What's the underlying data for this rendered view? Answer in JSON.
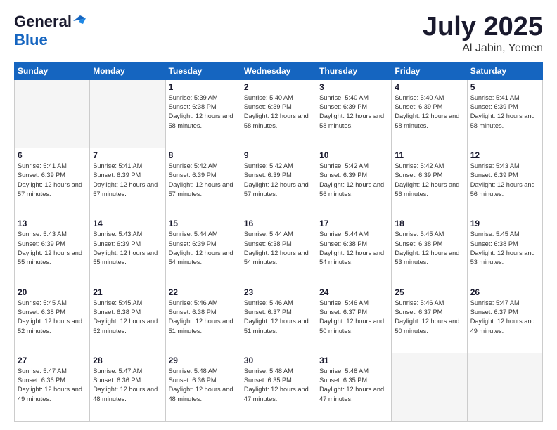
{
  "header": {
    "logo_general": "General",
    "logo_blue": "Blue",
    "month": "July 2025",
    "location": "Al Jabin, Yemen"
  },
  "days_of_week": [
    "Sunday",
    "Monday",
    "Tuesday",
    "Wednesday",
    "Thursday",
    "Friday",
    "Saturday"
  ],
  "weeks": [
    [
      {
        "day": "",
        "empty": true
      },
      {
        "day": "",
        "empty": true
      },
      {
        "day": "1",
        "sunrise": "Sunrise: 5:39 AM",
        "sunset": "Sunset: 6:38 PM",
        "daylight": "Daylight: 12 hours and 58 minutes."
      },
      {
        "day": "2",
        "sunrise": "Sunrise: 5:40 AM",
        "sunset": "Sunset: 6:39 PM",
        "daylight": "Daylight: 12 hours and 58 minutes."
      },
      {
        "day": "3",
        "sunrise": "Sunrise: 5:40 AM",
        "sunset": "Sunset: 6:39 PM",
        "daylight": "Daylight: 12 hours and 58 minutes."
      },
      {
        "day": "4",
        "sunrise": "Sunrise: 5:40 AM",
        "sunset": "Sunset: 6:39 PM",
        "daylight": "Daylight: 12 hours and 58 minutes."
      },
      {
        "day": "5",
        "sunrise": "Sunrise: 5:41 AM",
        "sunset": "Sunset: 6:39 PM",
        "daylight": "Daylight: 12 hours and 58 minutes."
      }
    ],
    [
      {
        "day": "6",
        "sunrise": "Sunrise: 5:41 AM",
        "sunset": "Sunset: 6:39 PM",
        "daylight": "Daylight: 12 hours and 57 minutes."
      },
      {
        "day": "7",
        "sunrise": "Sunrise: 5:41 AM",
        "sunset": "Sunset: 6:39 PM",
        "daylight": "Daylight: 12 hours and 57 minutes."
      },
      {
        "day": "8",
        "sunrise": "Sunrise: 5:42 AM",
        "sunset": "Sunset: 6:39 PM",
        "daylight": "Daylight: 12 hours and 57 minutes."
      },
      {
        "day": "9",
        "sunrise": "Sunrise: 5:42 AM",
        "sunset": "Sunset: 6:39 PM",
        "daylight": "Daylight: 12 hours and 57 minutes."
      },
      {
        "day": "10",
        "sunrise": "Sunrise: 5:42 AM",
        "sunset": "Sunset: 6:39 PM",
        "daylight": "Daylight: 12 hours and 56 minutes."
      },
      {
        "day": "11",
        "sunrise": "Sunrise: 5:42 AM",
        "sunset": "Sunset: 6:39 PM",
        "daylight": "Daylight: 12 hours and 56 minutes."
      },
      {
        "day": "12",
        "sunrise": "Sunrise: 5:43 AM",
        "sunset": "Sunset: 6:39 PM",
        "daylight": "Daylight: 12 hours and 56 minutes."
      }
    ],
    [
      {
        "day": "13",
        "sunrise": "Sunrise: 5:43 AM",
        "sunset": "Sunset: 6:39 PM",
        "daylight": "Daylight: 12 hours and 55 minutes."
      },
      {
        "day": "14",
        "sunrise": "Sunrise: 5:43 AM",
        "sunset": "Sunset: 6:39 PM",
        "daylight": "Daylight: 12 hours and 55 minutes."
      },
      {
        "day": "15",
        "sunrise": "Sunrise: 5:44 AM",
        "sunset": "Sunset: 6:39 PM",
        "daylight": "Daylight: 12 hours and 54 minutes."
      },
      {
        "day": "16",
        "sunrise": "Sunrise: 5:44 AM",
        "sunset": "Sunset: 6:38 PM",
        "daylight": "Daylight: 12 hours and 54 minutes."
      },
      {
        "day": "17",
        "sunrise": "Sunrise: 5:44 AM",
        "sunset": "Sunset: 6:38 PM",
        "daylight": "Daylight: 12 hours and 54 minutes."
      },
      {
        "day": "18",
        "sunrise": "Sunrise: 5:45 AM",
        "sunset": "Sunset: 6:38 PM",
        "daylight": "Daylight: 12 hours and 53 minutes."
      },
      {
        "day": "19",
        "sunrise": "Sunrise: 5:45 AM",
        "sunset": "Sunset: 6:38 PM",
        "daylight": "Daylight: 12 hours and 53 minutes."
      }
    ],
    [
      {
        "day": "20",
        "sunrise": "Sunrise: 5:45 AM",
        "sunset": "Sunset: 6:38 PM",
        "daylight": "Daylight: 12 hours and 52 minutes."
      },
      {
        "day": "21",
        "sunrise": "Sunrise: 5:45 AM",
        "sunset": "Sunset: 6:38 PM",
        "daylight": "Daylight: 12 hours and 52 minutes."
      },
      {
        "day": "22",
        "sunrise": "Sunrise: 5:46 AM",
        "sunset": "Sunset: 6:38 PM",
        "daylight": "Daylight: 12 hours and 51 minutes."
      },
      {
        "day": "23",
        "sunrise": "Sunrise: 5:46 AM",
        "sunset": "Sunset: 6:37 PM",
        "daylight": "Daylight: 12 hours and 51 minutes."
      },
      {
        "day": "24",
        "sunrise": "Sunrise: 5:46 AM",
        "sunset": "Sunset: 6:37 PM",
        "daylight": "Daylight: 12 hours and 50 minutes."
      },
      {
        "day": "25",
        "sunrise": "Sunrise: 5:46 AM",
        "sunset": "Sunset: 6:37 PM",
        "daylight": "Daylight: 12 hours and 50 minutes."
      },
      {
        "day": "26",
        "sunrise": "Sunrise: 5:47 AM",
        "sunset": "Sunset: 6:37 PM",
        "daylight": "Daylight: 12 hours and 49 minutes."
      }
    ],
    [
      {
        "day": "27",
        "sunrise": "Sunrise: 5:47 AM",
        "sunset": "Sunset: 6:36 PM",
        "daylight": "Daylight: 12 hours and 49 minutes."
      },
      {
        "day": "28",
        "sunrise": "Sunrise: 5:47 AM",
        "sunset": "Sunset: 6:36 PM",
        "daylight": "Daylight: 12 hours and 48 minutes."
      },
      {
        "day": "29",
        "sunrise": "Sunrise: 5:48 AM",
        "sunset": "Sunset: 6:36 PM",
        "daylight": "Daylight: 12 hours and 48 minutes."
      },
      {
        "day": "30",
        "sunrise": "Sunrise: 5:48 AM",
        "sunset": "Sunset: 6:35 PM",
        "daylight": "Daylight: 12 hours and 47 minutes."
      },
      {
        "day": "31",
        "sunrise": "Sunrise: 5:48 AM",
        "sunset": "Sunset: 6:35 PM",
        "daylight": "Daylight: 12 hours and 47 minutes."
      },
      {
        "day": "",
        "empty": true
      },
      {
        "day": "",
        "empty": true
      }
    ]
  ]
}
